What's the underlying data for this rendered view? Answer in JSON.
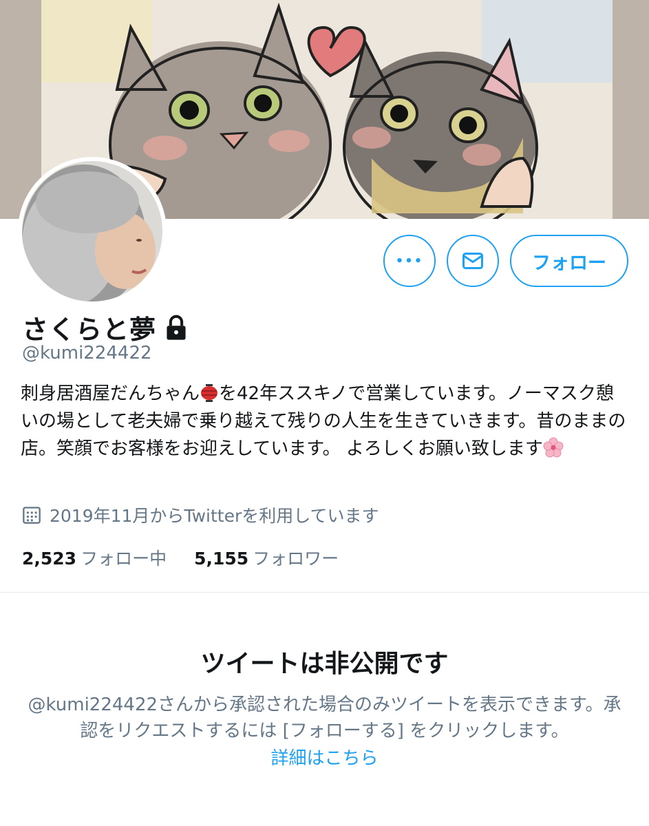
{
  "profile": {
    "name": "さくらと夢",
    "handle": "@kumi224422",
    "bio_part1": "刺身居酒屋だんちゃん",
    "bio_part2": "を42年ススキノで営業しています。ノーマスク憩いの場として老夫婦で乗り越えて残りの人生を生きていきます。昔のままの店。笑顔でお客様をお迎えしています。 よろしくお願い致します",
    "joined": "2019年11月からTwitterを利用しています"
  },
  "actions": {
    "more_label": "•••",
    "follow_label": "フォロー"
  },
  "stats": {
    "following_count": "2,523",
    "following_label": "フォロー中",
    "followers_count": "5,155",
    "followers_label": "フォロワー"
  },
  "private": {
    "title": "ツイートは非公開です",
    "body": "@kumi224422さんから承認された場合のみツイートを表示できます。承認をリクエストするには [フォローする] をクリックします。",
    "link": "詳細はこちら"
  },
  "colors": {
    "accent": "#1da1f2",
    "text_primary": "#14171a",
    "text_secondary": "#657786"
  },
  "icons": {
    "lock": "lock-icon",
    "mail": "mail-icon",
    "calendar": "calendar-icon",
    "lantern": "lantern-emoji",
    "flower": "cherry-blossom-emoji"
  }
}
